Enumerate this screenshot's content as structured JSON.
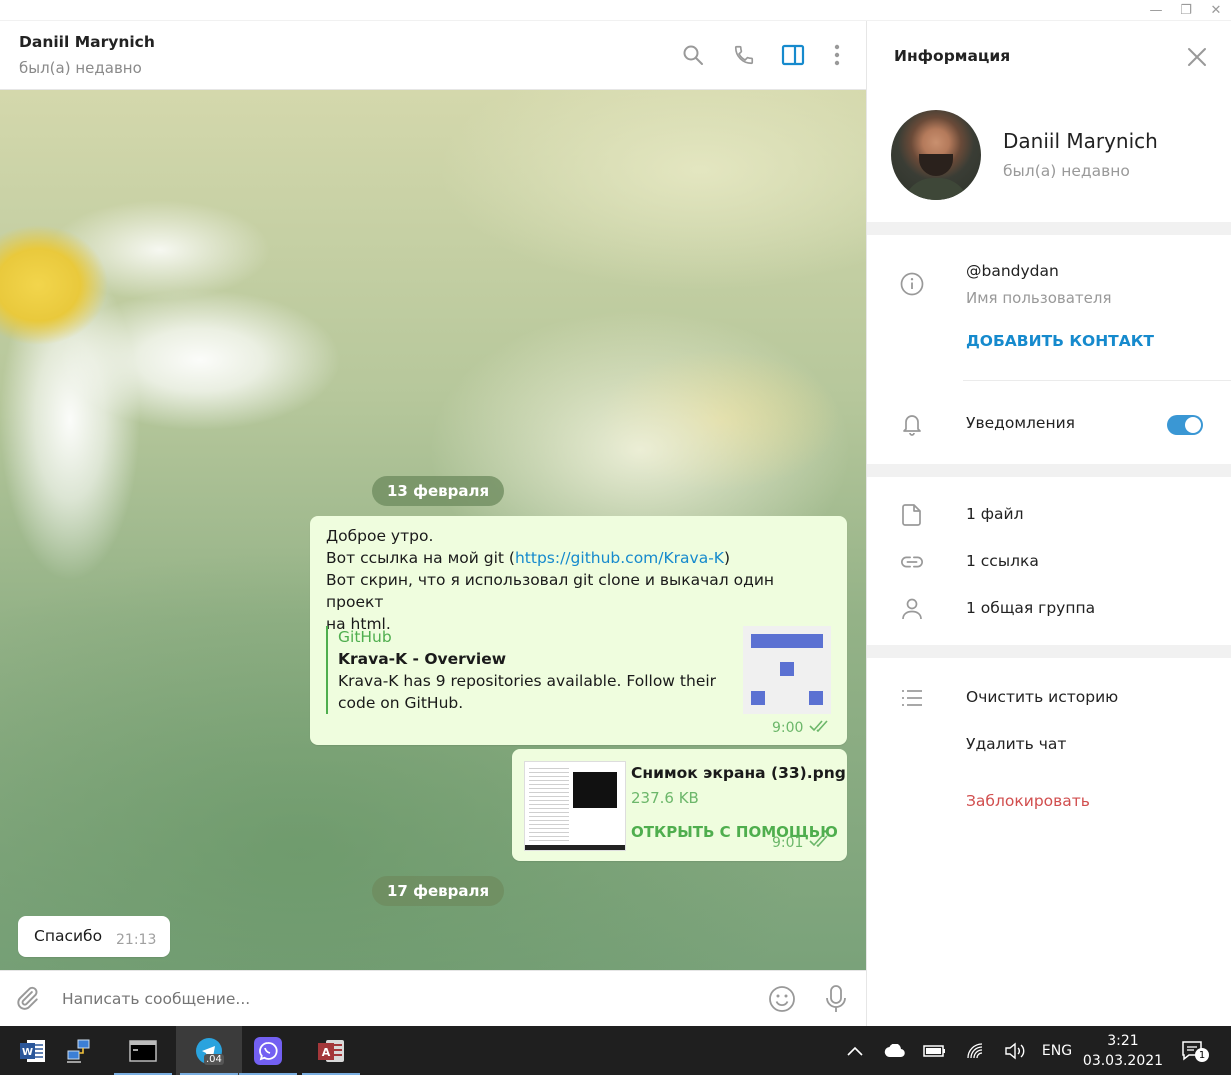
{
  "window": {
    "minimize": "—",
    "restore": "❐",
    "close": "✕"
  },
  "chat_header": {
    "name": "Daniil Marynich",
    "status": "был(а) недавно"
  },
  "messages": {
    "date1": "13 февраля",
    "msg1": {
      "line1": "Доброе утро.",
      "line2_prefix": "Вот ссылка на мой git (",
      "line2_link": "https://github.com/Krava-K",
      "line2_suffix": ")",
      "line3": "Вот скрин, что я использовал git clone и выкачал один проект",
      "line4": "на html.",
      "preview_site": "GitHub",
      "preview_title": "Krava-K - Overview",
      "preview_desc1": "Krava-K has 9 repositories available. Follow their",
      "preview_desc2": "code on GitHub.",
      "time": "9:00"
    },
    "msg2": {
      "file_name": "Снимок экрана (33).png",
      "file_size": "237.6 KB",
      "open_with": "ОТКРЫТЬ С ПОМОЩЬЮ",
      "time": "9:01"
    },
    "date2": "17 февраля",
    "msg3": {
      "text": "Спасибо",
      "time": "21:13"
    }
  },
  "composer": {
    "placeholder": "Написать сообщение..."
  },
  "info_panel": {
    "title": "Информация",
    "profile_name": "Daniil Marynich",
    "profile_status": "был(а) недавно",
    "username": "@bandydan",
    "username_label": "Имя пользователя",
    "add_contact": "ДОБАВИТЬ КОНТАКТ",
    "notifications": "Уведомления",
    "notifications_on": true,
    "files": "1 файл",
    "links": "1 ссылка",
    "groups": "1 общая группа",
    "clear_history": "Очистить историю",
    "delete_chat": "Удалить чат",
    "block": "Заблокировать"
  },
  "taskbar": {
    "telegram_badge": ".04",
    "lang": "ENG",
    "time": "3:21",
    "date": "03.03.2021",
    "notif_count": "1"
  },
  "colors": {
    "accent": "#168acd",
    "green": "#4fae4e",
    "danger": "#d14e4e",
    "bubble_out": "#effdde",
    "toggle": "#3a97d4"
  }
}
